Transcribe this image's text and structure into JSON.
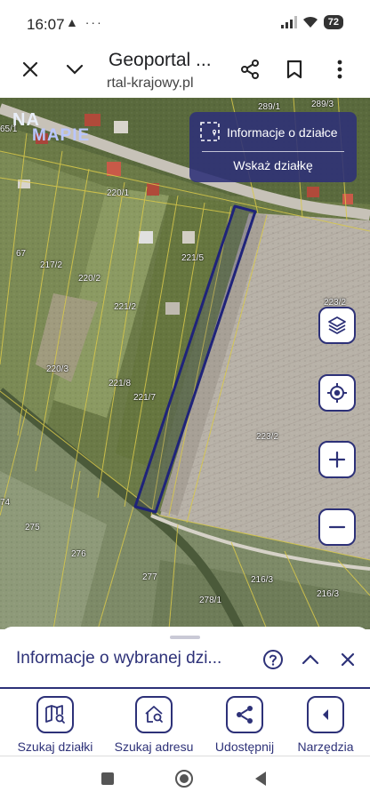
{
  "status_bar": {
    "time": "16:07",
    "left_icons": "▲ ···",
    "battery": "72"
  },
  "browser": {
    "title": "Geoportal ...",
    "url": "rtal-krajowy.pl",
    "icons": [
      "close-icon",
      "chevron-down-icon",
      "share-icon",
      "bookmark-icon",
      "more-vert-icon"
    ]
  },
  "map": {
    "logo_line1": "NA",
    "logo_line2": "MAPIE",
    "info_panel": {
      "label": "Informacje o działce",
      "action": "Wskaż działkę"
    },
    "parcel_labels": [
      "289/1",
      "289/3",
      "65/1",
      "220/1",
      "67",
      "217/2",
      "220/2",
      "221/5",
      "223/2",
      "221/2",
      "220/3",
      "221/8",
      "221/7",
      "223/2",
      "74",
      "275",
      "276",
      "277",
      "216/3",
      "216/3",
      "278/1"
    ],
    "controls": [
      "layers-icon",
      "locate-icon",
      "zoom-in-icon",
      "zoom-out-icon"
    ],
    "accent_color": "#2d3178"
  },
  "sheet": {
    "title": "Informacje o wybranej dzi..."
  },
  "toolbar": {
    "items": [
      {
        "label": "Szukaj działki",
        "icon": "map-search-icon"
      },
      {
        "label": "Szukaj adresu",
        "icon": "home-search-icon"
      },
      {
        "label": "Udostępnij",
        "icon": "share-icon"
      },
      {
        "label": "Narzędzia",
        "icon": "chevron-left-icon"
      }
    ]
  },
  "navbar": {
    "icons": [
      "recents-icon",
      "home-icon",
      "back-icon"
    ]
  }
}
